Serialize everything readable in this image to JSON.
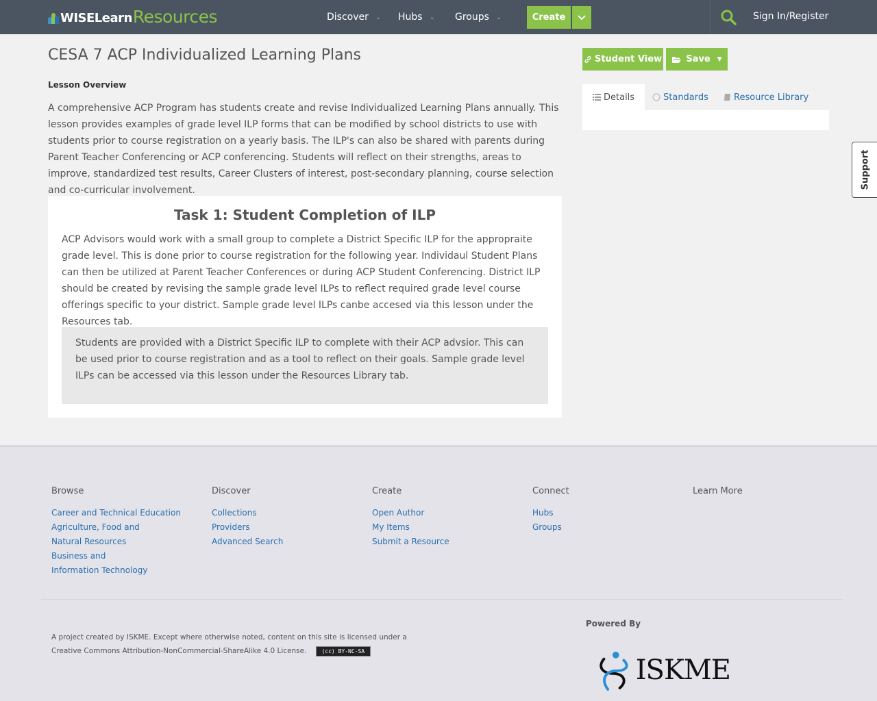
{
  "header": {
    "logo_wise": "WISELearn",
    "logo_resources": "Resources",
    "nav": [
      {
        "label": "Discover"
      },
      {
        "label": "Hubs"
      },
      {
        "label": "Groups"
      }
    ],
    "create_label": "Create",
    "signin_label": "Sign In/Register"
  },
  "main": {
    "title": "CESA 7 ACP Individualized Learning Plans",
    "overview_label": "Lesson Overview",
    "overview_text": "A comprehensive ACP Program has students create and revise Individualized Learning Plans annually.  This lesson provides examples of grade level ILP forms that can be modified by school districts to use with students prior to course registration on a yearly basis.  The ILP's can also be shared with parents during Parent Teacher Conferencing or ACP conferencing.  Students will reflect on their strengths, areas to improve, standardized test results, Career Clusters of interest, post-secondary planning, course selection and co-curricular involvement.",
    "task": {
      "title": "Task 1: Student Completion of ILP",
      "body": "ACP Advisors would work with a small group to complete a District Specific ILP for the appropraite grade level.  This is done prior to course registration for the following year.  Individaul Student Plans can then be utilized at Parent Teacher Conferences or during ACP Student Conferencing.  District ILP should be created by revising the sample grade level ILPs to reflect required grade level course offerings specific to your district.  Sample grade level ILPs canbe accesed via this lesson under the Resources tab.",
      "box": "Students are provided with a District Specific ILP to complete with their ACP advsior.  This can be used prior to course registration and as a tool to reflect on their goals.  Sample grade level ILPs can be accessed via this lesson under the Resources Library tab."
    }
  },
  "sidebar": {
    "student_view_label": "Student View",
    "save_label": "Save",
    "tabs": [
      {
        "label": "Details"
      },
      {
        "label": "Standards"
      },
      {
        "label": "Resource Library"
      }
    ]
  },
  "support_label": "Support",
  "footer": {
    "columns": [
      {
        "heading": "Browse",
        "links": [
          "Career and Technical Education",
          "Agriculture, Food and Natural Resources",
          "Business and Information Technology"
        ]
      },
      {
        "heading": "Discover",
        "links": [
          "Collections",
          "Providers",
          "Advanced Search"
        ]
      },
      {
        "heading": "Create",
        "links": [
          "Open Author",
          "My Items",
          "Submit a Resource"
        ]
      },
      {
        "heading": "Connect",
        "links": [
          "Hubs",
          "Groups"
        ]
      },
      {
        "heading": "Learn More",
        "links": []
      }
    ],
    "license_text": "A project created by ISKME. Except where otherwise noted, content on this site is licensed under a Creative Commons Attribution-NonCommercial-ShareAlike 4.0 License.",
    "cc_badge": "(cc) BY-NC-SA",
    "powered_by": "Powered By",
    "iskme_logo": "ISKME"
  },
  "colors": {
    "header_bg": "#4b5461",
    "accent_green": "#8bc34a",
    "link_blue": "#2a6fb0",
    "footer_bg": "#e3e3e9"
  },
  "icons": [
    "search-icon",
    "chevron-down-icon",
    "link-icon",
    "folder-open-icon",
    "list-icon",
    "circle-icon",
    "book-icon"
  ]
}
